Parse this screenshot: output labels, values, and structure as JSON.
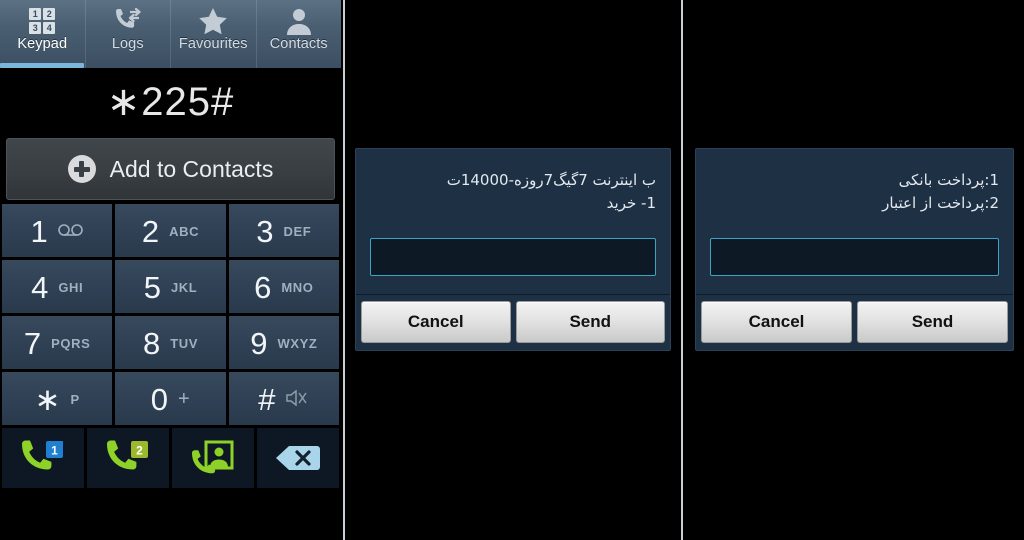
{
  "dialer": {
    "tabs": [
      {
        "label": "Keypad",
        "icon": "keypad-icon",
        "active": true
      },
      {
        "label": "Logs",
        "icon": "call-logs-icon",
        "active": false
      },
      {
        "label": "Favourites",
        "icon": "star-icon",
        "active": false
      },
      {
        "label": "Contacts",
        "icon": "person-icon",
        "active": false
      }
    ],
    "display_number": "∗225#",
    "add_to_contacts": {
      "label": "Add to Contacts",
      "icon": "plus-circle-icon"
    },
    "keys": [
      {
        "digit": "1",
        "sub": "⌀⌀",
        "sub_style": "voicemail"
      },
      {
        "digit": "2",
        "sub": "ABC",
        "sub_style": "letters"
      },
      {
        "digit": "3",
        "sub": "DEF",
        "sub_style": "letters"
      },
      {
        "digit": "4",
        "sub": "GHI",
        "sub_style": "letters"
      },
      {
        "digit": "5",
        "sub": "JKL",
        "sub_style": "letters"
      },
      {
        "digit": "6",
        "sub": "MNO",
        "sub_style": "letters"
      },
      {
        "digit": "7",
        "sub": "PQRS",
        "sub_style": "letters"
      },
      {
        "digit": "8",
        "sub": "TUV",
        "sub_style": "letters"
      },
      {
        "digit": "9",
        "sub": "WXYZ",
        "sub_style": "letters"
      },
      {
        "digit": "∗",
        "sub": "P",
        "sub_style": "letters"
      },
      {
        "digit": "0",
        "sub": "+",
        "sub_style": "plus"
      },
      {
        "digit": "#",
        "sub": "⌨",
        "sub_style": "mute"
      }
    ],
    "actions": [
      {
        "name": "call-sim1-button",
        "icon": "phone-sim1-icon",
        "badge": "1",
        "badge_color": "#1f7fd1"
      },
      {
        "name": "call-sim2-button",
        "icon": "phone-sim2-icon",
        "badge": "2",
        "badge_color": "#9cb82b"
      },
      {
        "name": "video-call-button",
        "icon": "video-contact-icon",
        "badge": "",
        "badge_color": ""
      },
      {
        "name": "backspace-button",
        "icon": "backspace-icon",
        "badge": "",
        "badge_color": ""
      }
    ],
    "colors": {
      "key_face": "#2f4054",
      "tab_bar": "#4a5e72",
      "active_tab_indicator": "#7cb6dd",
      "call_green": "#8ed128",
      "backspace_blue": "#a9d5ea"
    }
  },
  "ussd_dialog_1": {
    "message_line_1": "ب اینترنت 7گیگ7روزه-14000ت",
    "message_line_2": "1- خرید",
    "input_value": "",
    "input_placeholder": "",
    "cancel_label": "Cancel",
    "send_label": "Send"
  },
  "ussd_dialog_2": {
    "message_line_1": "1:پرداخت بانکی",
    "message_line_2": "2:پرداخت از اعتبار",
    "input_value": "",
    "input_placeholder": "",
    "cancel_label": "Cancel",
    "send_label": "Send"
  },
  "theme": {
    "dialog_bg": "#1d3044",
    "dialog_input_border": "#3ba3c6",
    "background": "#000000"
  }
}
